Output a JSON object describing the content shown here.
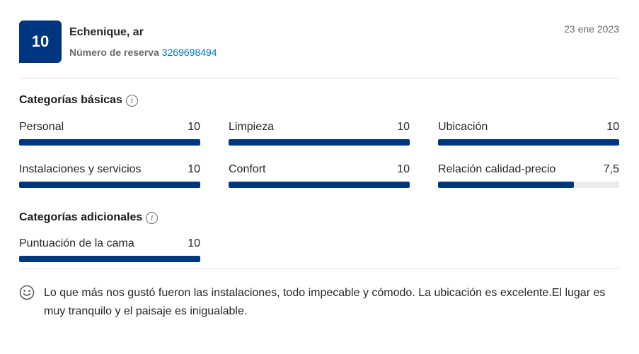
{
  "review": {
    "score": "10",
    "reviewer": "Echenique, ar",
    "booking_label": "Número de reserva",
    "booking_number": "3269698494",
    "date": "23 ene 2023"
  },
  "basic": {
    "title": "Categorías básicas",
    "categories": [
      {
        "label": "Personal",
        "value": "10",
        "fraction": 1.0
      },
      {
        "label": "Limpieza",
        "value": "10",
        "fraction": 1.0
      },
      {
        "label": "Ubicación",
        "value": "10",
        "fraction": 1.0
      },
      {
        "label": "Instalaciones y servicios",
        "value": "10",
        "fraction": 1.0
      },
      {
        "label": "Confort",
        "value": "10",
        "fraction": 1.0
      },
      {
        "label": "Relación calidad-precio",
        "value": "7,5",
        "fraction": 0.75
      }
    ]
  },
  "additional": {
    "title": "Categorías adicionales",
    "categories": [
      {
        "label": "Puntuación de la cama",
        "value": "10",
        "fraction": 1.0
      }
    ]
  },
  "comment": {
    "icon": "smile-icon",
    "text": "Lo que más nos gustó fueron las instalaciones, todo impecable y cómodo. La ubicación es excelente.El lugar es muy tranquilo y el paisaje es inigualable."
  },
  "colors": {
    "brand": "#003580",
    "link": "#0071c2",
    "track": "#ebebeb"
  }
}
